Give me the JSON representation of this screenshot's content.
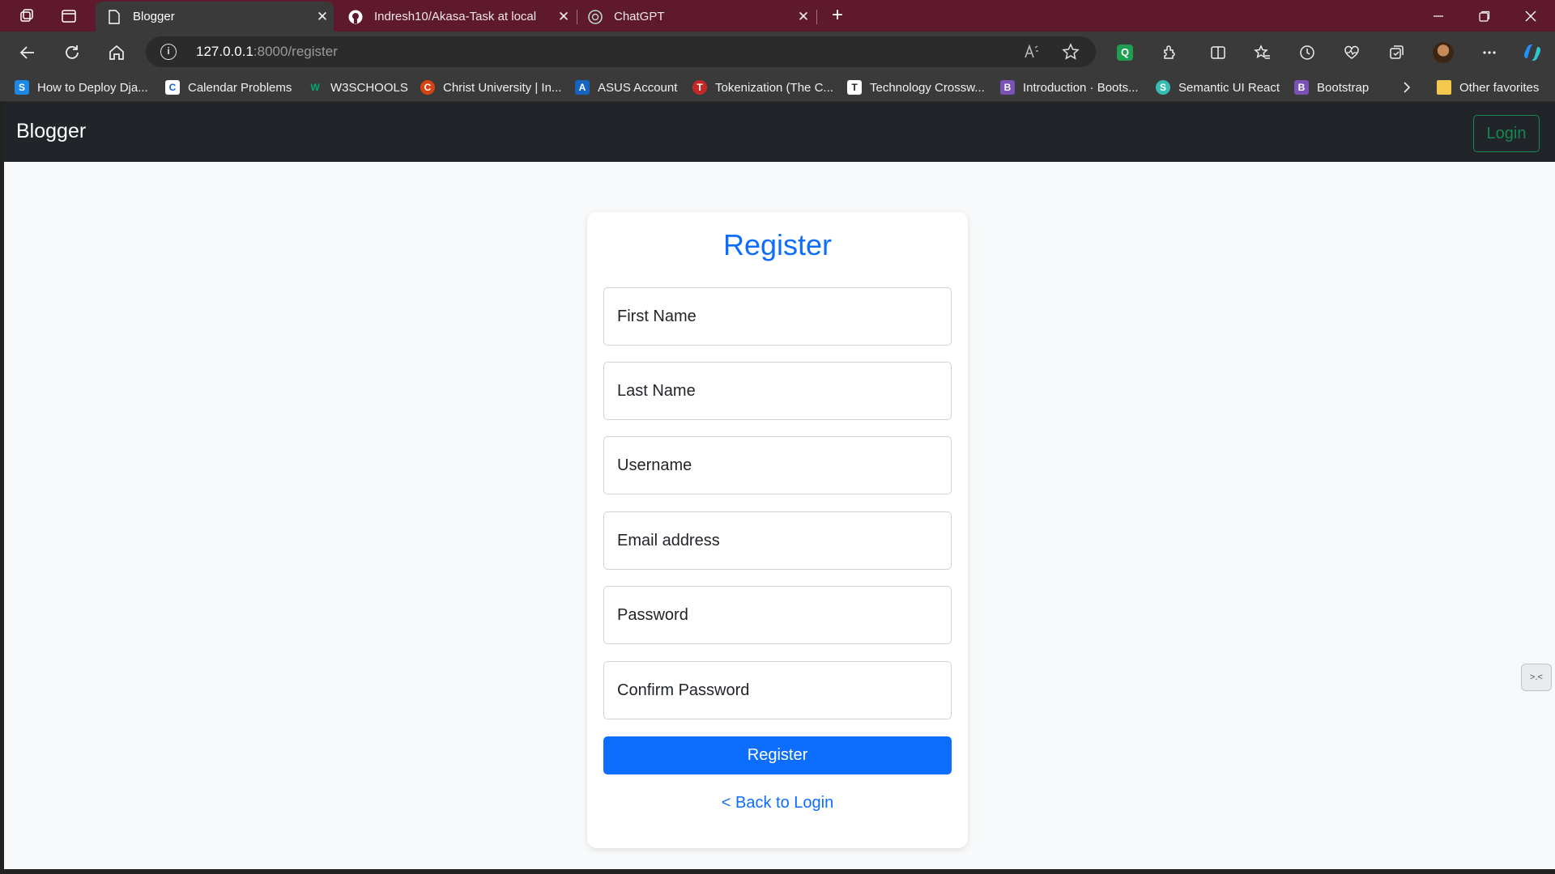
{
  "browser": {
    "tabs": [
      {
        "title": "Blogger",
        "active": true
      },
      {
        "title": "Indresh10/Akasa-Task at local",
        "active": false
      },
      {
        "title": "ChatGPT",
        "active": false
      }
    ],
    "new_tab_label": "+",
    "close_glyph": "✕",
    "address": {
      "host": "127.0.0.1",
      "path": ":8000/register"
    },
    "profile_badge": "Q",
    "bookmarks": [
      {
        "label": "How to Deploy Dja...",
        "icon": "S",
        "color": "#1e88e5"
      },
      {
        "label": "Calendar Problems",
        "icon": "C",
        "color": "#ffffff"
      },
      {
        "label": "W3SCHOOLS",
        "icon": "W",
        "color": "#04aa6d"
      },
      {
        "label": "Christ University | In...",
        "icon": "C",
        "color": "#d84315"
      },
      {
        "label": "ASUS Account",
        "icon": "A",
        "color": "#1565c0"
      },
      {
        "label": "Tokenization (The C...",
        "icon": "T",
        "color": "#c62828"
      },
      {
        "label": "Technology Crossw...",
        "icon": "T",
        "color": "#ffffff"
      },
      {
        "label": "Introduction · Boots...",
        "icon": "B",
        "color": "#7952b3"
      },
      {
        "label": "Semantic UI React",
        "icon": "S",
        "color": "#35bdb2"
      },
      {
        "label": "Bootstrap",
        "icon": "B",
        "color": "#7952b3"
      }
    ],
    "other_favorites": "Other favorites"
  },
  "navbar": {
    "brand": "Blogger",
    "login_label": "Login",
    "login_color": "#198754"
  },
  "form": {
    "title": "Register",
    "accent": "#0d6efd",
    "first_name_placeholder": "First Name",
    "last_name_placeholder": "Last Name",
    "username_placeholder": "Username",
    "email_placeholder": "Email address",
    "password_placeholder": "Password",
    "confirm_password_placeholder": "Confirm Password",
    "submit_label": "Register",
    "back_link": "< Back to Login"
  }
}
